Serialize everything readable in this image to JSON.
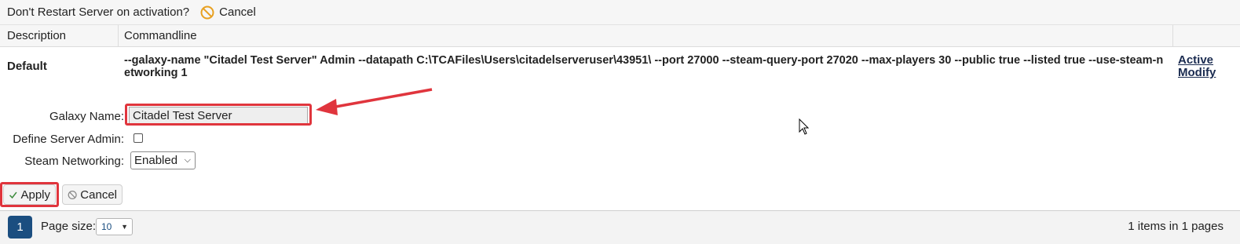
{
  "topbar": {
    "question": "Don't Restart Server on activation?",
    "cancel_label": "Cancel"
  },
  "table": {
    "headers": [
      "Description",
      "Commandline"
    ],
    "row": {
      "description": "Default",
      "commandline": "--galaxy-name \"Citadel Test Server\" Admin --datapath C:\\TCAFiles\\Users\\citadelserveruser\\43951\\ --port 27000 --steam-query-port 27020 --max-players 30 --public true --listed true --use-steam-networking 1",
      "active_link": "Active",
      "modify_link": "Modify"
    }
  },
  "form": {
    "galaxy_name_label": "Galaxy Name:",
    "galaxy_name_value": "Citadel Test Server",
    "define_admin_label": "Define Server Admin:",
    "define_admin_checked": false,
    "steam_networking_label": "Steam Networking:",
    "steam_networking_value": "Enabled",
    "apply_label": "Apply",
    "cancel_label": "Cancel"
  },
  "pager": {
    "current_page": "1",
    "page_size_label": "Page size:",
    "page_size_value": "10",
    "info": "1 items in 1 pages"
  },
  "colors": {
    "highlight": "#e0353d",
    "pager_active": "#1b4e80",
    "cancel_icon": "#e8a020"
  },
  "icons": {
    "top_cancel": "no-entry-icon",
    "apply": "checkmark-icon",
    "form_cancel": "cancel-circle-icon",
    "dropdown": "chevron-down-icon"
  }
}
